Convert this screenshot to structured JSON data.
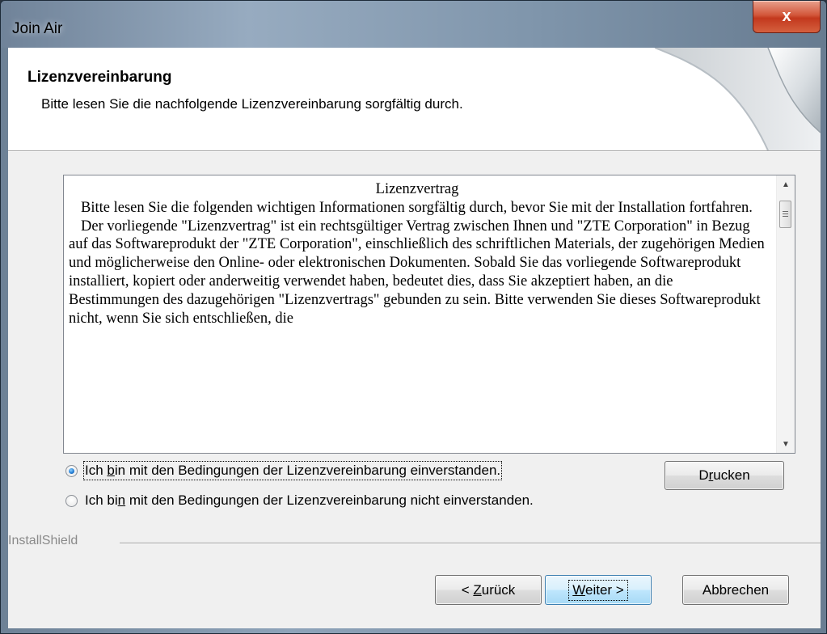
{
  "window": {
    "title": "Join Air",
    "close_label": "x"
  },
  "header": {
    "title": "Lizenzvereinbarung",
    "subtitle": "Bitte lesen Sie die nachfolgende Lizenzvereinbarung sorgfältig durch."
  },
  "license": {
    "title": "Lizenzvertrag",
    "paragraphs": [
      "Bitte lesen Sie die folgenden wichtigen Informationen sorgfältig durch, bevor Sie mit der Installation fortfahren.",
      "Der vorliegende \"Lizenzvertrag\" ist ein rechtsgültiger Vertrag zwischen Ihnen und \"ZTE Corporation\" in Bezug auf das Softwareprodukt der \"ZTE Corporation\", einschließlich des schriftlichen Materials, der zugehörigen Medien und möglicherweise den Online- oder elektronischen Dokumenten. Sobald Sie das vorliegende Softwareprodukt installiert, kopiert oder anderweitig verwendet haben, bedeutet dies, dass Sie akzeptiert haben, an die Bestimmungen des dazugehörigen \"Lizenzvertrags\" gebunden zu sein. Bitte verwenden Sie dieses Softwareprodukt nicht, wenn Sie sich entschließen, die"
    ]
  },
  "options": {
    "accept": {
      "pre": "Ich ",
      "key": "b",
      "post": "in mit den Bedingungen der Lizenzvereinbarung einverstanden.",
      "selected": true
    },
    "decline": {
      "pre": "Ich bi",
      "key": "n",
      "post": " mit den Bedingungen der Lizenzvereinbarung nicht einverstanden.",
      "selected": false
    }
  },
  "buttons": {
    "print": {
      "pre": "D",
      "key": "r",
      "post": "ucken"
    },
    "back": {
      "pre": "< ",
      "key": "Z",
      "post": "urück"
    },
    "next": {
      "pre": "",
      "key": "W",
      "post": "eiter >"
    },
    "cancel": "Abbrechen"
  },
  "footer": {
    "brand": "InstallShield"
  },
  "colors": {
    "accent": "#1f78d1",
    "close_button": "#c3381d"
  }
}
